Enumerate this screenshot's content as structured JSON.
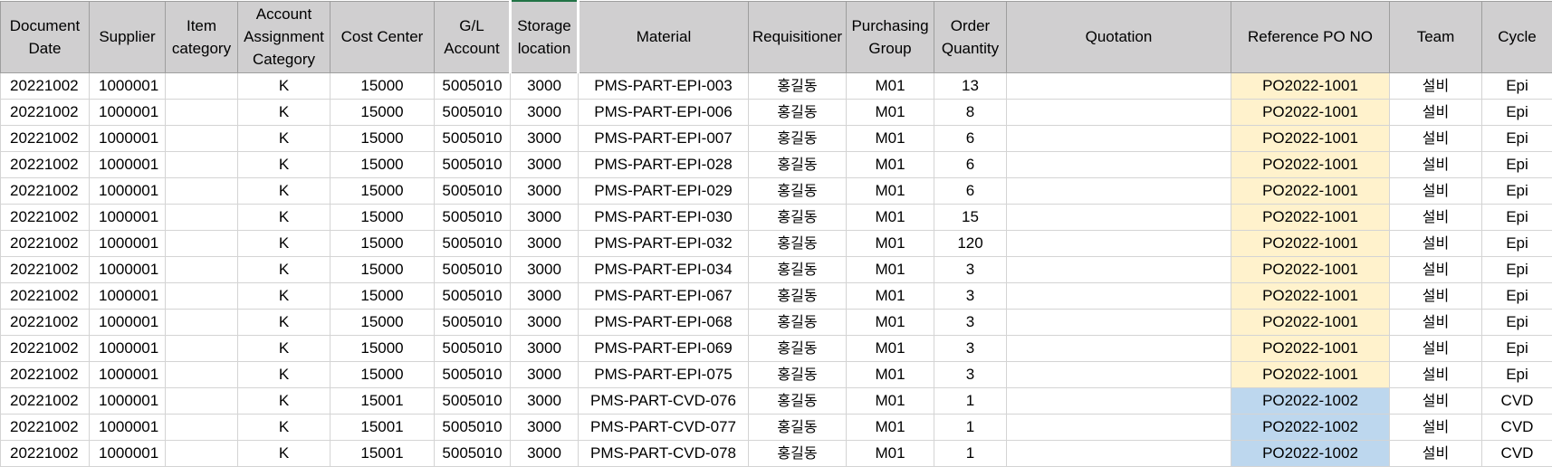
{
  "sheet": {
    "headers": [
      "Document Date",
      "Supplier",
      "Item category",
      "Account Assignment Category",
      "Cost Center",
      "G/L Account",
      "Storage location",
      "Material",
      "Requisitioner",
      "Purchasing Group",
      "Order Quantity",
      "Quotation",
      "Reference PO NO",
      "Team",
      "Cycle"
    ],
    "ref_colors": {
      "PO2022-1001": "#fff2cc",
      "PO2022-1002": "#bdd7ee"
    },
    "rows": [
      {
        "date": "20221002",
        "supplier": "1000001",
        "item_category": "",
        "acct_cat": "K",
        "cost_center": "15000",
        "gl": "5005010",
        "storage": "3000",
        "material": "PMS-PART-EPI-003",
        "requisitioner": "홍길동",
        "pgroup": "M01",
        "qty": "13",
        "quotation": "",
        "ref_po": "PO2022-1001",
        "team": "설비",
        "cycle": "Epi"
      },
      {
        "date": "20221002",
        "supplier": "1000001",
        "item_category": "",
        "acct_cat": "K",
        "cost_center": "15000",
        "gl": "5005010",
        "storage": "3000",
        "material": "PMS-PART-EPI-006",
        "requisitioner": "홍길동",
        "pgroup": "M01",
        "qty": "8",
        "quotation": "",
        "ref_po": "PO2022-1001",
        "team": "설비",
        "cycle": "Epi"
      },
      {
        "date": "20221002",
        "supplier": "1000001",
        "item_category": "",
        "acct_cat": "K",
        "cost_center": "15000",
        "gl": "5005010",
        "storage": "3000",
        "material": "PMS-PART-EPI-007",
        "requisitioner": "홍길동",
        "pgroup": "M01",
        "qty": "6",
        "quotation": "",
        "ref_po": "PO2022-1001",
        "team": "설비",
        "cycle": "Epi"
      },
      {
        "date": "20221002",
        "supplier": "1000001",
        "item_category": "",
        "acct_cat": "K",
        "cost_center": "15000",
        "gl": "5005010",
        "storage": "3000",
        "material": "PMS-PART-EPI-028",
        "requisitioner": "홍길동",
        "pgroup": "M01",
        "qty": "6",
        "quotation": "",
        "ref_po": "PO2022-1001",
        "team": "설비",
        "cycle": "Epi"
      },
      {
        "date": "20221002",
        "supplier": "1000001",
        "item_category": "",
        "acct_cat": "K",
        "cost_center": "15000",
        "gl": "5005010",
        "storage": "3000",
        "material": "PMS-PART-EPI-029",
        "requisitioner": "홍길동",
        "pgroup": "M01",
        "qty": "6",
        "quotation": "",
        "ref_po": "PO2022-1001",
        "team": "설비",
        "cycle": "Epi"
      },
      {
        "date": "20221002",
        "supplier": "1000001",
        "item_category": "",
        "acct_cat": "K",
        "cost_center": "15000",
        "gl": "5005010",
        "storage": "3000",
        "material": "PMS-PART-EPI-030",
        "requisitioner": "홍길동",
        "pgroup": "M01",
        "qty": "15",
        "quotation": "",
        "ref_po": "PO2022-1001",
        "team": "설비",
        "cycle": "Epi"
      },
      {
        "date": "20221002",
        "supplier": "1000001",
        "item_category": "",
        "acct_cat": "K",
        "cost_center": "15000",
        "gl": "5005010",
        "storage": "3000",
        "material": "PMS-PART-EPI-032",
        "requisitioner": "홍길동",
        "pgroup": "M01",
        "qty": "120",
        "quotation": "",
        "ref_po": "PO2022-1001",
        "team": "설비",
        "cycle": "Epi"
      },
      {
        "date": "20221002",
        "supplier": "1000001",
        "item_category": "",
        "acct_cat": "K",
        "cost_center": "15000",
        "gl": "5005010",
        "storage": "3000",
        "material": "PMS-PART-EPI-034",
        "requisitioner": "홍길동",
        "pgroup": "M01",
        "qty": "3",
        "quotation": "",
        "ref_po": "PO2022-1001",
        "team": "설비",
        "cycle": "Epi"
      },
      {
        "date": "20221002",
        "supplier": "1000001",
        "item_category": "",
        "acct_cat": "K",
        "cost_center": "15000",
        "gl": "5005010",
        "storage": "3000",
        "material": "PMS-PART-EPI-067",
        "requisitioner": "홍길동",
        "pgroup": "M01",
        "qty": "3",
        "quotation": "",
        "ref_po": "PO2022-1001",
        "team": "설비",
        "cycle": "Epi"
      },
      {
        "date": "20221002",
        "supplier": "1000001",
        "item_category": "",
        "acct_cat": "K",
        "cost_center": "15000",
        "gl": "5005010",
        "storage": "3000",
        "material": "PMS-PART-EPI-068",
        "requisitioner": "홍길동",
        "pgroup": "M01",
        "qty": "3",
        "quotation": "",
        "ref_po": "PO2022-1001",
        "team": "설비",
        "cycle": "Epi"
      },
      {
        "date": "20221002",
        "supplier": "1000001",
        "item_category": "",
        "acct_cat": "K",
        "cost_center": "15000",
        "gl": "5005010",
        "storage": "3000",
        "material": "PMS-PART-EPI-069",
        "requisitioner": "홍길동",
        "pgroup": "M01",
        "qty": "3",
        "quotation": "",
        "ref_po": "PO2022-1001",
        "team": "설비",
        "cycle": "Epi"
      },
      {
        "date": "20221002",
        "supplier": "1000001",
        "item_category": "",
        "acct_cat": "K",
        "cost_center": "15000",
        "gl": "5005010",
        "storage": "3000",
        "material": "PMS-PART-EPI-075",
        "requisitioner": "홍길동",
        "pgroup": "M01",
        "qty": "3",
        "quotation": "",
        "ref_po": "PO2022-1001",
        "team": "설비",
        "cycle": "Epi"
      },
      {
        "date": "20221002",
        "supplier": "1000001",
        "item_category": "",
        "acct_cat": "K",
        "cost_center": "15001",
        "gl": "5005010",
        "storage": "3000",
        "material": "PMS-PART-CVD-076",
        "requisitioner": "홍길동",
        "pgroup": "M01",
        "qty": "1",
        "quotation": "",
        "ref_po": "PO2022-1002",
        "team": "설비",
        "cycle": "CVD"
      },
      {
        "date": "20221002",
        "supplier": "1000001",
        "item_category": "",
        "acct_cat": "K",
        "cost_center": "15001",
        "gl": "5005010",
        "storage": "3000",
        "material": "PMS-PART-CVD-077",
        "requisitioner": "홍길동",
        "pgroup": "M01",
        "qty": "1",
        "quotation": "",
        "ref_po": "PO2022-1002",
        "team": "설비",
        "cycle": "CVD"
      },
      {
        "date": "20221002",
        "supplier": "1000001",
        "item_category": "",
        "acct_cat": "K",
        "cost_center": "15001",
        "gl": "5005010",
        "storage": "3000",
        "material": "PMS-PART-CVD-078",
        "requisitioner": "홍길동",
        "pgroup": "M01",
        "qty": "1",
        "quotation": "",
        "ref_po": "PO2022-1002",
        "team": "설비",
        "cycle": "CVD"
      }
    ]
  }
}
